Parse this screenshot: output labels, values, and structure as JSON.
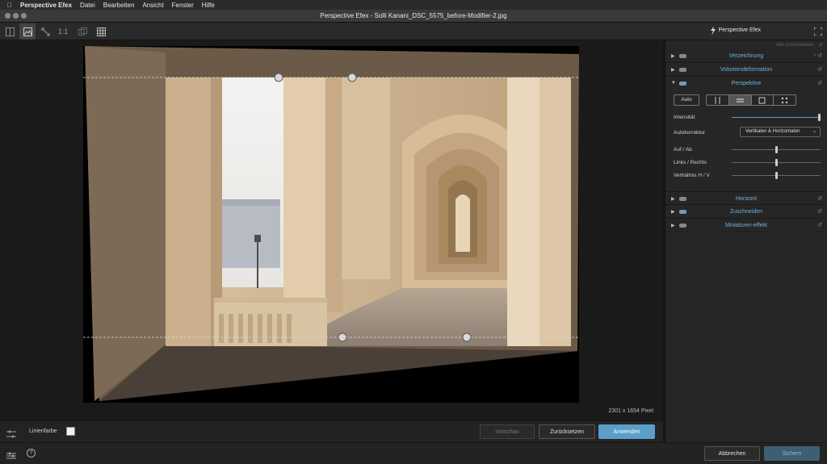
{
  "menubar": {
    "app_name": "Perspective Efex",
    "items": [
      "Datei",
      "Bearbeiten",
      "Ansicht",
      "Fenster",
      "Hilfe"
    ]
  },
  "window": {
    "title": "Perspective Efex - Solli Kanani_DSC_5575_before-Modifier-2.jpg"
  },
  "toolbar": {
    "zoom_label": "1:1",
    "plugin_name": "Perspective Efex"
  },
  "canvas": {
    "image_size": "2301 x 1654 Pixel"
  },
  "bottom_bar": {
    "line_color_label": "Linienfarbe",
    "preview_label": "Vorschau",
    "reset_label": "Zurücksetzen",
    "apply_label": "Anwenden",
    "cancel_label": "Abbrechen",
    "save_label": "Sichern"
  },
  "panel": {
    "reset_all": "Alle zurücksetzen",
    "sections": {
      "distortion": "Verzeichnung",
      "volume": "Volumendeformation",
      "perspective": "Perspektive",
      "horizon": "Horizont",
      "crop": "Zuschneiden",
      "miniature": "Miniaturen-effekt"
    },
    "perspective": {
      "auto_label": "Auto",
      "intensity_label": "Intensität",
      "intensity_value": 1.0,
      "autocorrect_label": "Autokorrektur",
      "autocorrect_value": "Vertikalen & Horizontalen",
      "up_down_label": "Auf / Ab",
      "up_down_value": 0.5,
      "left_right_label": "Links / Rechts",
      "left_right_value": 0.5,
      "ratio_label": "Verhältnis H / V",
      "ratio_value": 0.5
    }
  },
  "colors": {
    "accent": "#5b9ec8",
    "section_title": "#6fb2e0"
  }
}
